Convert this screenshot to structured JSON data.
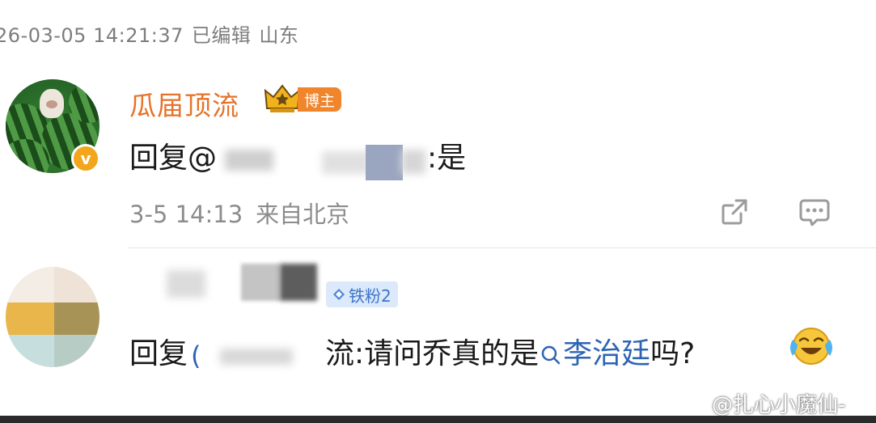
{
  "top_meta": {
    "time": "26-03-05 14:21:37",
    "edited": "已编辑",
    "location": "山东"
  },
  "reply1": {
    "author": "瓜届顶流",
    "badge": "博主",
    "reply_prefix": "回复@",
    "blurred_mention_tail": ":是",
    "time": "3-5 14:13",
    "location": "来自北京",
    "avatar_badge": "v"
  },
  "reply2": {
    "fan_badge": "铁粉2",
    "reply_prefix": "回复",
    "mention_tail": "流:请问乔真的是",
    "topic_link": "李治廷",
    "question_end": "吗?"
  },
  "watermark": "@扎心小魔仙-",
  "icons": [
    "crown-icon",
    "verified-v-icon",
    "share-icon",
    "comment-icon",
    "diamond-icon",
    "search-icon",
    "laughing-crying-emoji",
    "weibo-logo-icon"
  ],
  "colors": {
    "author": "#e5732a",
    "badge": "#f0852c",
    "topic_link": "#2e64b4",
    "fan_badge_bg": "#dbe9fb"
  }
}
